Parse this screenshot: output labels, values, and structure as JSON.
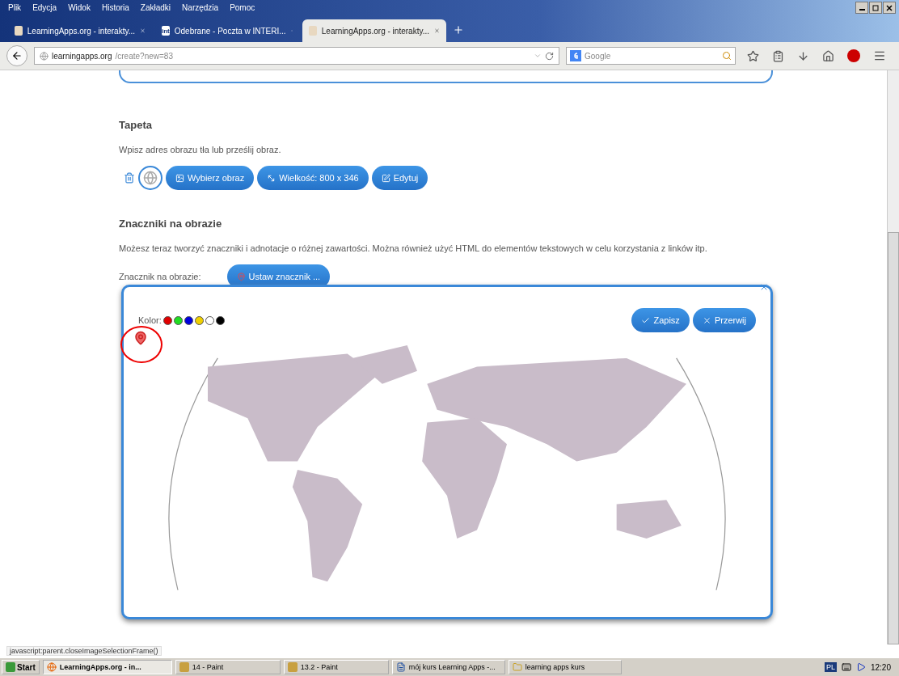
{
  "menu": [
    "Plik",
    "Edycja",
    "Widok",
    "Historia",
    "Zakładki",
    "Narzędzia",
    "Pomoc"
  ],
  "tabs": [
    {
      "label": "LearningApps.org - interakty...",
      "selected": false,
      "kind": "la"
    },
    {
      "label": "Odebrane - Poczta w INTERI...",
      "selected": false,
      "kind": "int"
    },
    {
      "label": "LearningApps.org - interakty...",
      "selected": true,
      "kind": "la"
    }
  ],
  "address": {
    "host": "learningapps.org",
    "path": "/create?new=83"
  },
  "search": {
    "placeholder": "Google"
  },
  "wallpaper": {
    "title": "Tapeta",
    "description": "Wpisz adres obrazu tła lub prześlij obraz.",
    "buttons": [
      {
        "kind": "image",
        "label": "Wybierz obraz"
      },
      {
        "kind": "size",
        "label": "Wielkość: 800 x 346"
      },
      {
        "kind": "edit",
        "label": "Edytuj"
      }
    ]
  },
  "markers": {
    "title": "Znaczniki na obrazie",
    "description": "Możesz teraz tworzyć znaczniki i adnotacje o różnej zawartości. Można również użyć HTML do elementów tekstowych w celu korzystania z linków itp.",
    "label": "Znacznik na obrazie:",
    "button": "Ustaw znacznik ..."
  },
  "editor": {
    "color_label": "Kolor:",
    "colors": [
      {
        "color": "#e00000"
      },
      {
        "color": "#22dd22"
      },
      {
        "color": "#0000dd"
      },
      {
        "color": "#f0d000"
      },
      {
        "color": "#ffffff"
      },
      {
        "color": "#000000"
      }
    ],
    "save": "Zapisz",
    "cancel": "Przerwij"
  },
  "status_text": "javascript:parent.closeImageSelectionFrame()",
  "taskbar": {
    "start": "Start",
    "items": [
      {
        "label": "LearningApps.org - in...",
        "selected": true,
        "kind": "browser"
      },
      {
        "label": "14 - Paint",
        "selected": false,
        "kind": "paint"
      },
      {
        "label": "13.2 - Paint",
        "selected": false,
        "kind": "paint"
      },
      {
        "label": "mój kurs Learning Apps -...",
        "selected": false,
        "kind": "doc"
      },
      {
        "label": "learning apps kurs",
        "selected": false,
        "kind": "folder"
      }
    ],
    "language": "PL",
    "clock": "12:20"
  }
}
